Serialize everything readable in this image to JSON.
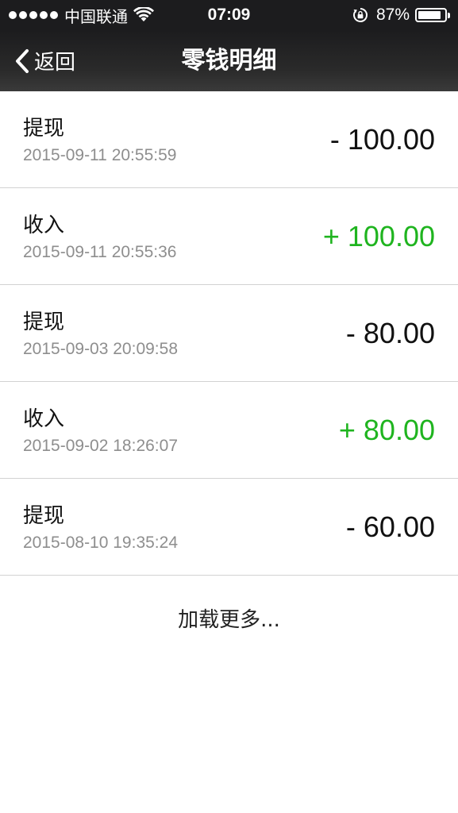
{
  "status_bar": {
    "carrier": "中国联通",
    "time": "07:09",
    "battery_percent": "87%",
    "battery_level": 0.87,
    "signal_bars": 5,
    "icons": [
      "signal-dots-icon",
      "wifi-icon",
      "rotation-lock-icon",
      "battery-icon"
    ]
  },
  "nav": {
    "back_label": "返回",
    "title": "零钱明细",
    "back_icon": "chevron-left-icon"
  },
  "transactions": [
    {
      "type": "提现",
      "time": "2015-09-11 20:55:59",
      "amount": "- 100.00",
      "direction": "negative"
    },
    {
      "type": "收入",
      "time": "2015-09-11 20:55:36",
      "amount": "+ 100.00",
      "direction": "positive"
    },
    {
      "type": "提现",
      "time": "2015-09-03 20:09:58",
      "amount": "- 80.00",
      "direction": "negative"
    },
    {
      "type": "收入",
      "time": "2015-09-02 18:26:07",
      "amount": "+ 80.00",
      "direction": "positive"
    },
    {
      "type": "提现",
      "time": "2015-08-10 19:35:24",
      "amount": "- 60.00",
      "direction": "negative"
    }
  ],
  "load_more_label": "加载更多...",
  "colors": {
    "income": "#1fb41f",
    "withdrawal": "#111111",
    "nav_background": "#1c1c1e",
    "timestamp": "#8e8e8e"
  }
}
